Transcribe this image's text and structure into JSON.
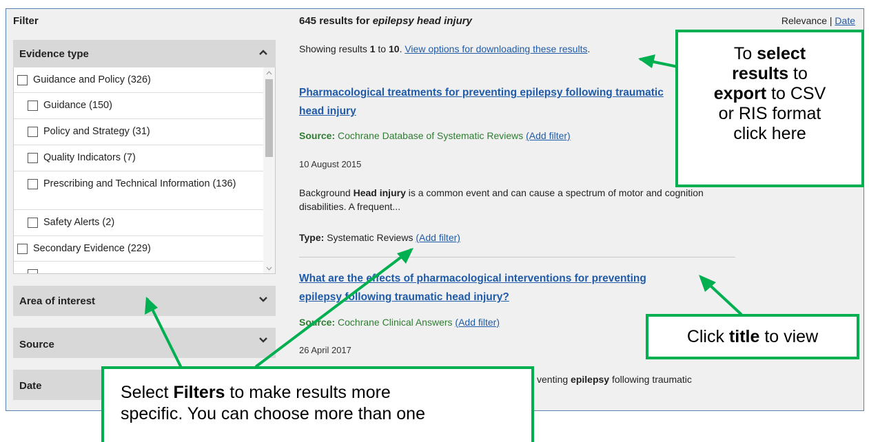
{
  "sidebar": {
    "filter_title": "Filter",
    "evidence_type_label": "Evidence type",
    "evidence_items": [
      {
        "label": "Guidance and Policy (326)",
        "level": 0
      },
      {
        "label": "Guidance (150)",
        "level": 1
      },
      {
        "label": "Policy and Strategy (31)",
        "level": 1
      },
      {
        "label": "Quality Indicators (7)",
        "level": 1
      },
      {
        "label": "Prescribing and Technical Information (136)",
        "level": 1
      },
      {
        "label": "Safety Alerts (2)",
        "level": 1
      },
      {
        "label": "Secondary Evidence (229)",
        "level": 0
      }
    ],
    "area_label": "Area of interest",
    "source_label": "Source",
    "date_label": "Date"
  },
  "results": {
    "count_text": "645 results for ",
    "query": "epilepsy head injury",
    "sort_relevance": "Relevance",
    "sort_sep": " | ",
    "sort_date": "Date",
    "showing_prefix": "Showing results ",
    "showing_from": "1",
    "showing_mid": " to ",
    "showing_to": "10",
    "showing_dot": ". ",
    "download_link": "View options for downloading these results",
    "download_dot": ".",
    "r1": {
      "title_a": "Pharmacological treatments for preventing ",
      "title_kw1": "epilepsy",
      "title_b": " following traumatic ",
      "title_kw2": "head injury",
      "source_label": "Source:",
      "source": " Cochrane Database of Systematic Reviews ",
      "add_filter": "(Add filter)",
      "date": "10 August 2015",
      "snippet_a": "Background ",
      "snippet_kw": "Head injury",
      "snippet_b": " is a common event and can cause a spectrum of motor and cognition disabilities. A frequent...",
      "type_label": "Type:",
      "type": " Systematic Reviews ",
      "type_add_filter": "(Add filter)"
    },
    "r2": {
      "title_a": "What are the effects of pharmacological interventions for preventing ",
      "title_kw1": "epilepsy",
      "title_b": " following traumatic ",
      "title_kw2": "head injury",
      "title_c": "?",
      "source_label": "Source:",
      "source": " Cochrane Clinical Answers ",
      "add_filter": "(Add filter)",
      "date": "26 April 2017"
    },
    "r3_snippet_a": "venting ",
    "r3_snippet_kw": "epilepsy",
    "r3_snippet_b": " following traumatic"
  },
  "callouts": {
    "export": {
      "l1a": "To ",
      "l1b": "select",
      "l2": "results",
      "l2b": " to",
      "l3": "export",
      "l3b": " to CSV",
      "l4": "or RIS format",
      "l5": "click here"
    },
    "title": {
      "a": "Click ",
      "b": "title",
      "c": " to view"
    },
    "filters": {
      "a": "Select ",
      "b": "Filters",
      "c": " to make results more",
      "d": "specific. You can choose more than one"
    }
  },
  "colors": {
    "accent_green": "#00b050",
    "link_blue": "#1f5ba8",
    "source_green": "#2e7d32"
  },
  "icons": {
    "chevron_up": "chevron-up-icon",
    "chevron_down": "chevron-down-icon",
    "checkbox": "checkbox-icon",
    "arrow": "callout-arrow"
  }
}
